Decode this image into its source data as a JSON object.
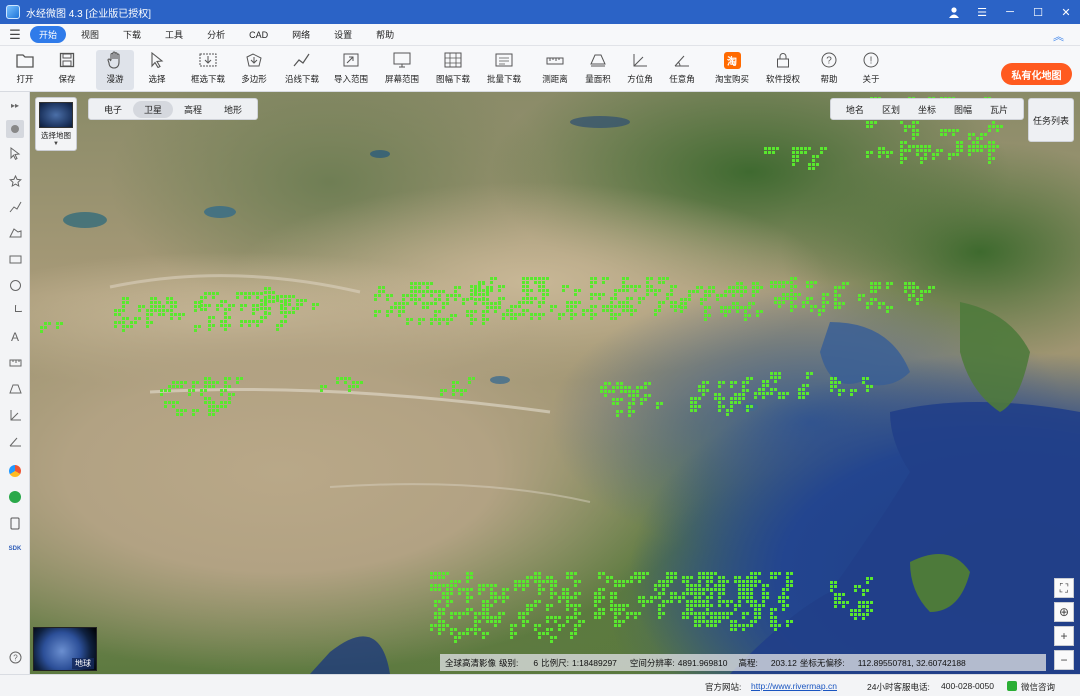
{
  "window": {
    "title": "水经微图 4.3 [企业版已授权]"
  },
  "menu": {
    "items": [
      "开始",
      "视图",
      "下载",
      "工具",
      "分析",
      "CAD",
      "网络",
      "设置",
      "帮助"
    ],
    "active_index": 0
  },
  "ribbon": {
    "tools": [
      "打开",
      "保存",
      "漫游",
      "选择",
      "框选下载",
      "多边形",
      "沿线下载",
      "导入范围",
      "屏幕范围",
      "图幅下载",
      "批量下载",
      "测距离",
      "量面积",
      "方位角",
      "任意角",
      "淘宝购买",
      "软件授权",
      "帮助",
      "关于"
    ],
    "active_tool": "漫游",
    "private_map_button": "私有化地图"
  },
  "map": {
    "type_tabs": [
      "电子",
      "卫星",
      "高程",
      "地形"
    ],
    "active_type": "卫星",
    "chooser_label": "选择地图",
    "layer_items": [
      "地名",
      "区划",
      "坐标",
      "图幅",
      "瓦片"
    ],
    "task_list": "任务列表",
    "globe_label": "地球",
    "info": {
      "source": "全球高清影像",
      "level_label": "级别:",
      "level": "6",
      "scale_label": "比例尺:",
      "scale": "1:18489297",
      "resolution_label": "空间分辨率:",
      "resolution": "4891.969810",
      "elevation_label": "高程:",
      "elevation": "203.12",
      "coord_label": "坐标无偏移:",
      "coord": "112.89550781, 32.60742188"
    },
    "dot_color": "#59e82e"
  },
  "status": {
    "site_label": "官方网站:",
    "site_url": "http://www.rivermap.cn",
    "tel_label": "24小时客服电话:",
    "tel": "400-028-0050",
    "wechat": "微信咨询"
  }
}
